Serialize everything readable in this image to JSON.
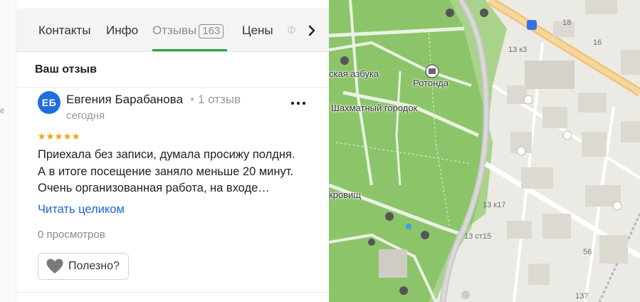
{
  "gutter": {
    "fragment": "ё"
  },
  "tabs": {
    "items": [
      {
        "label": "Контакты"
      },
      {
        "label": "Инфо"
      },
      {
        "label": "Отзывы",
        "count": "163",
        "active": true
      },
      {
        "label": "Цены"
      },
      {
        "label": "Ф"
      }
    ],
    "next_icon": "chevron-right-icon"
  },
  "section": {
    "title": "Ваш отзыв"
  },
  "review": {
    "avatar_initials": "ЕБ",
    "avatar_color": "#1f6fe0",
    "author": "Евгения Барабанова",
    "separator": "•",
    "author_reviews": "1 отзыв",
    "date": "сегодня",
    "more_icon": "more-dots-icon",
    "rating": 5,
    "star_color": "#f5a623",
    "text": "Приехала без записи, думала просижу полдня.\nА в итоге посещение заняло меньше 20 минут.\nОчень организованная работа, на входе…",
    "read_more": "Читать целиком",
    "views": "0 просмотров",
    "useful_label": "Полезно?",
    "useful_icon": "heart-icon"
  },
  "accent_color": "#29a638",
  "link_color": "#1e66d6",
  "map": {
    "labels": {
      "azbuka": "ская азбука",
      "rotonda": "Ротонда",
      "chess": "Шахматный городок",
      "krovish": "кровищ"
    },
    "numbers": {
      "n18": "18",
      "n16": "16",
      "n13k3": "13 к3",
      "n13k17": "13 к17",
      "n13st15": "13 ст15",
      "n56": "56",
      "n137": "137"
    }
  }
}
